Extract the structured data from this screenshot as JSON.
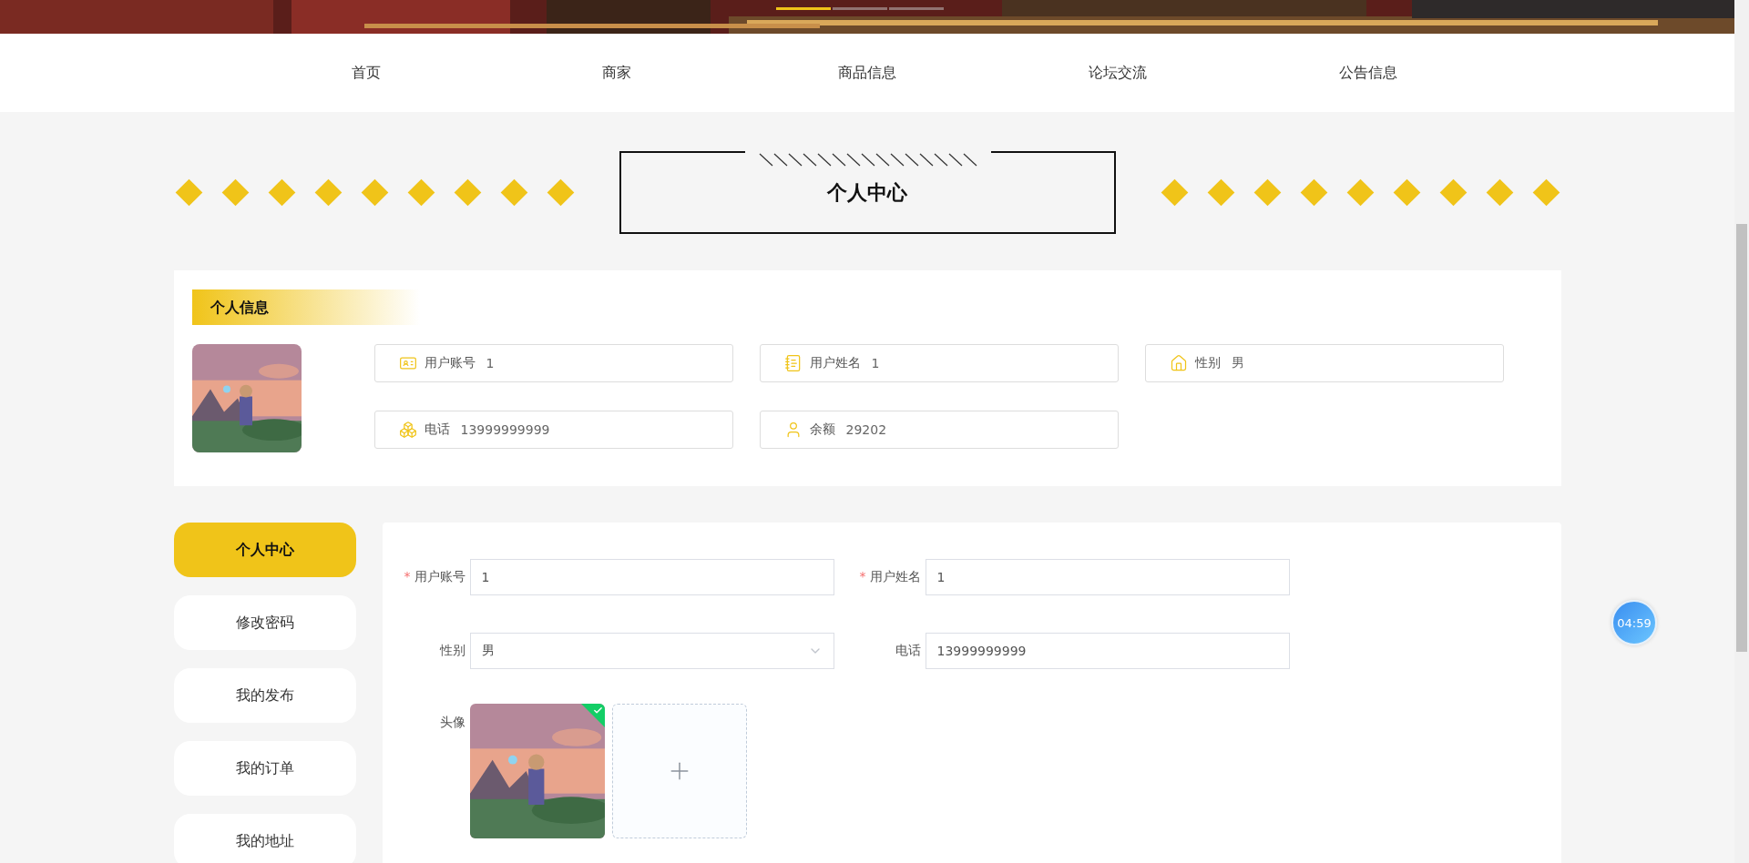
{
  "banner": {
    "kind": "picture",
    "indicators": [
      {
        "selected": true
      },
      {
        "selected": false
      },
      {
        "selected": false
      }
    ]
  },
  "nav": [
    "首页",
    "商家",
    "商品信息",
    "论坛交流",
    "公告信息"
  ],
  "page_title": "个人中心",
  "profile_card": {
    "title": "个人信息",
    "fields": [
      {
        "label": "用户账号",
        "value": "1"
      },
      {
        "label": "用户姓名",
        "value": "1"
      },
      {
        "label": "性别",
        "value": "男"
      },
      {
        "label": "电话",
        "value": "13999999999"
      },
      {
        "label": "余额",
        "value": "29202"
      }
    ]
  },
  "side_menu": [
    {
      "label": "个人中心",
      "selected": true
    },
    {
      "label": "修改密码",
      "selected": false
    },
    {
      "label": "我的发布",
      "selected": false
    },
    {
      "label": "我的订单",
      "selected": false
    },
    {
      "label": "我的地址",
      "selected": false
    }
  ],
  "form": {
    "required_mark": "*",
    "fields": [
      {
        "label": "用户账号",
        "required": true,
        "kind": "text",
        "value": "1"
      },
      {
        "label": "用户姓名",
        "required": true,
        "kind": "text",
        "value": "1"
      },
      {
        "label": "性别",
        "required": false,
        "kind": "select",
        "value": "男"
      },
      {
        "label": "电话",
        "required": false,
        "kind": "text",
        "value": "13999999999"
      }
    ],
    "avatar": {
      "label": "头像",
      "uploaded": true
    }
  },
  "timer": "04:59"
}
